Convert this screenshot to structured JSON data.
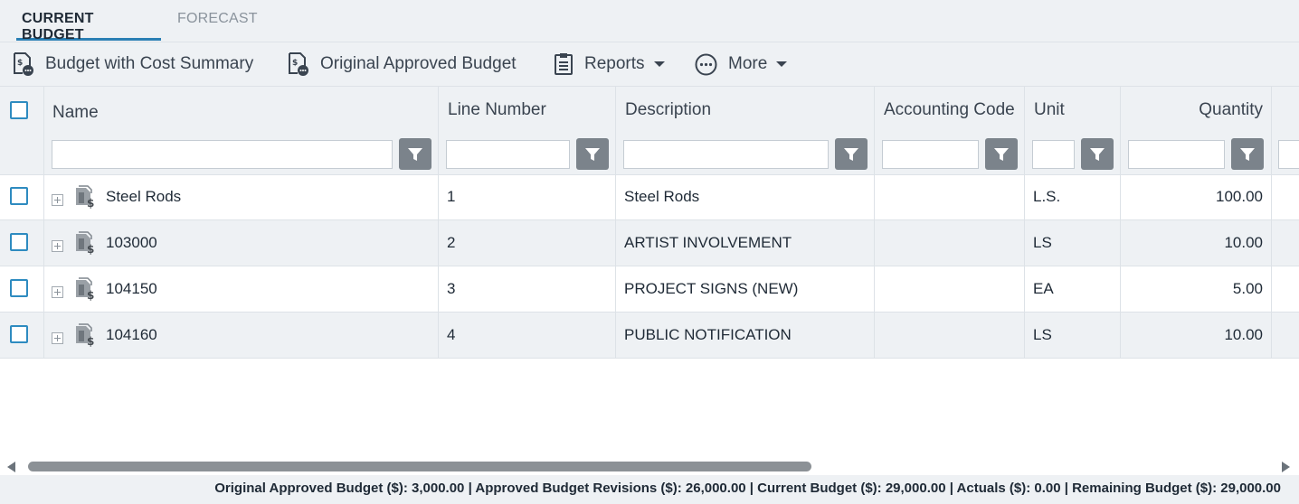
{
  "tabs": [
    {
      "label": "CURRENT BUDGET",
      "active": true
    },
    {
      "label": "FORECAST",
      "active": false
    }
  ],
  "toolbar": {
    "budget_summary_label": "Budget with Cost Summary",
    "original_budget_label": "Original Approved Budget",
    "reports_label": "Reports",
    "more_label": "More"
  },
  "columns": {
    "name": "Name",
    "line_number": "Line Number",
    "description": "Description",
    "accounting_code": "Accounting Code",
    "unit": "Unit",
    "quantity": "Quantity"
  },
  "rows": [
    {
      "name": "Steel Rods",
      "line": "1",
      "description": "Steel Rods",
      "accounting_code": "",
      "unit": "L.S.",
      "quantity": "100.00"
    },
    {
      "name": "103000",
      "line": "2",
      "description": "ARTIST INVOLVEMENT",
      "accounting_code": "",
      "unit": "LS",
      "quantity": "10.00"
    },
    {
      "name": "104150",
      "line": "3",
      "description": "PROJECT SIGNS (NEW)",
      "accounting_code": "",
      "unit": "EA",
      "quantity": "5.00"
    },
    {
      "name": "104160",
      "line": "4",
      "description": "PUBLIC NOTIFICATION",
      "accounting_code": "",
      "unit": "LS",
      "quantity": "10.00"
    }
  ],
  "footer": {
    "summary": "Original Approved Budget ($): 3,000.00 | Approved Budget Revisions ($): 26,000.00 | Current Budget ($): 29,000.00 | Actuals ($): 0.00 | Remaining Budget ($): 29,000.00"
  },
  "colors": {
    "accent": "#2a7fb4",
    "checkbox": "#2e8bc0",
    "filter_button": "#7b838b",
    "panel_bg": "#eef1f4"
  },
  "icons": {
    "budget_summary": "budget-document-icon",
    "original_budget": "budget-document-icon",
    "reports": "clipboard-icon",
    "more": "ellipsis-circle-icon",
    "filter": "funnel-icon",
    "row": "budget-item-icon"
  }
}
